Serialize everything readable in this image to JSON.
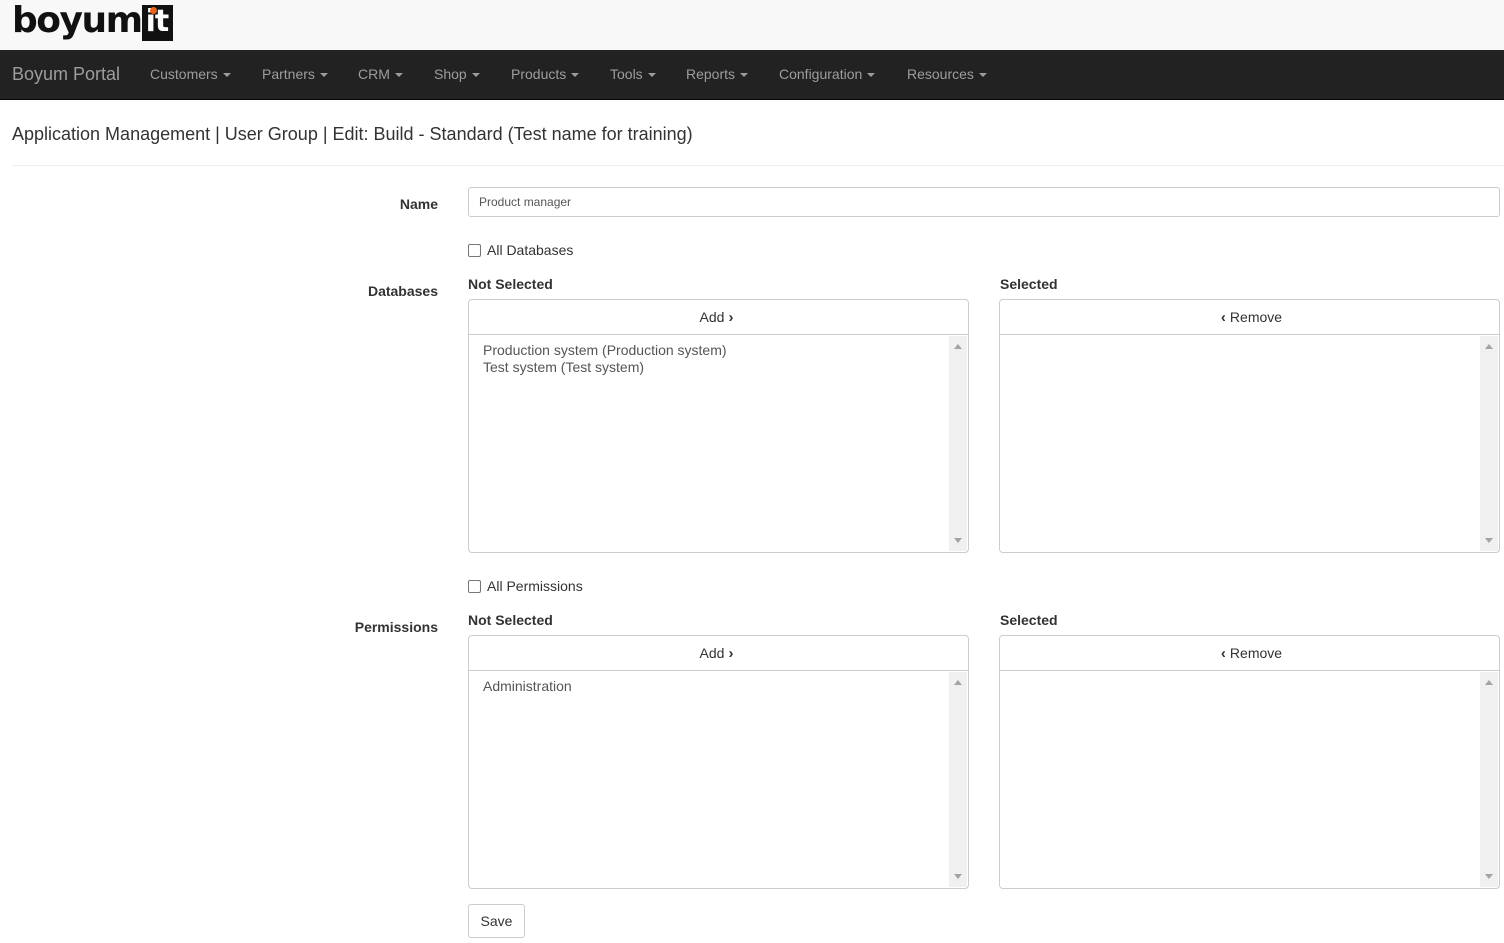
{
  "logo": {
    "text": "boyum",
    "box_text": "it",
    "accent": "#e8641c"
  },
  "navbar": {
    "brand": "Boyum Portal",
    "items": [
      {
        "label": "Customers"
      },
      {
        "label": "Partners"
      },
      {
        "label": "CRM"
      },
      {
        "label": "Shop"
      },
      {
        "label": "Products"
      },
      {
        "label": "Tools"
      },
      {
        "label": "Reports"
      },
      {
        "label": "Configuration"
      },
      {
        "label": "Resources"
      }
    ]
  },
  "page": {
    "title": "Application Management | User Group | Edit: Build - Standard (Test name for training)"
  },
  "form": {
    "name_label": "Name",
    "name_value": "Product manager",
    "databases": {
      "label": "Databases",
      "all_label": "All Databases",
      "not_selected_heading": "Not Selected",
      "selected_heading": "Selected",
      "add_label": "Add",
      "remove_label": "Remove",
      "not_selected_items": [
        "Production system (Production system)",
        "Test system (Test system)"
      ],
      "selected_items": []
    },
    "permissions": {
      "label": "Permissions",
      "all_label": "All Permissions",
      "not_selected_heading": "Not Selected",
      "selected_heading": "Selected",
      "add_label": "Add",
      "remove_label": "Remove",
      "not_selected_items": [
        "Administration"
      ],
      "selected_items": []
    },
    "save_label": "Save"
  }
}
